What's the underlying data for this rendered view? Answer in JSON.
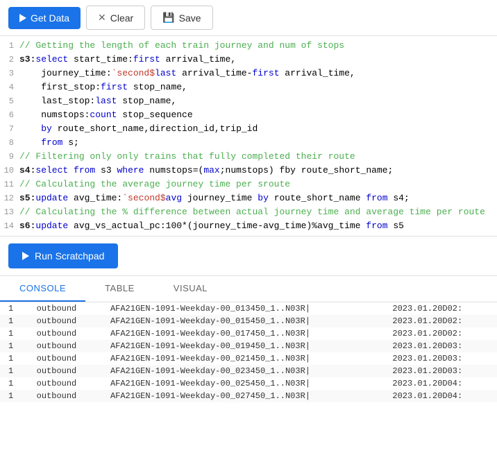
{
  "toolbar": {
    "get_data_label": "Get Data",
    "clear_label": "Clear",
    "save_label": "Save"
  },
  "code": {
    "lines": [
      {
        "num": 1,
        "text": "// Getting the length of each train journey and num of stops",
        "type": "comment"
      },
      {
        "num": 2,
        "text": "s3:select start_time:first arrival_time,",
        "type": "code"
      },
      {
        "num": 3,
        "text": "    journey_time:`second$last arrival_time-first arrival_time,",
        "type": "code"
      },
      {
        "num": 4,
        "text": "    first_stop:first stop_name,",
        "type": "code"
      },
      {
        "num": 5,
        "text": "    last_stop:last stop_name,",
        "type": "code"
      },
      {
        "num": 6,
        "text": "    numstops:count stop_sequence",
        "type": "code"
      },
      {
        "num": 7,
        "text": "    by route_short_name,direction_id,trip_id",
        "type": "code"
      },
      {
        "num": 8,
        "text": "    from s;",
        "type": "code"
      },
      {
        "num": 9,
        "text": "// Filtering only only trains that fully completed their route",
        "type": "comment"
      },
      {
        "num": 10,
        "text": "s4:select from s3 where numstops=(max;numstops) fby route_short_name;",
        "type": "code"
      },
      {
        "num": 11,
        "text": "// Calculating the average journey time per sroute",
        "type": "comment"
      },
      {
        "num": 12,
        "text": "s5:update avg_time:`second$avg journey_time by route_short_name from s4;",
        "type": "code"
      },
      {
        "num": 13,
        "text": "// Calculating the % difference between actual journey time and average time per route",
        "type": "comment"
      },
      {
        "num": 14,
        "text": "s6:update avg_vs_actual_pc:100*(journey_time-avg_time)%avg_time from s5",
        "type": "code"
      }
    ]
  },
  "run_button_label": "Run Scratchpad",
  "tabs": [
    "CONSOLE",
    "TABLE",
    "VISUAL"
  ],
  "active_tab": "CONSOLE",
  "console_rows": [
    {
      "num": "1",
      "dir": "outbound",
      "trip": "AFA21GEN-1091-Weekday-00_013450_1..N03R|",
      "date": "2023.01.20D02:"
    },
    {
      "num": "1",
      "dir": "outbound",
      "trip": "AFA21GEN-1091-Weekday-00_015450_1..N03R|",
      "date": "2023.01.20D02:"
    },
    {
      "num": "1",
      "dir": "outbound",
      "trip": "AFA21GEN-1091-Weekday-00_017450_1..N03R|",
      "date": "2023.01.20D02:"
    },
    {
      "num": "1",
      "dir": "outbound",
      "trip": "AFA21GEN-1091-Weekday-00_019450_1..N03R|",
      "date": "2023.01.20D03:"
    },
    {
      "num": "1",
      "dir": "outbound",
      "trip": "AFA21GEN-1091-Weekday-00_021450_1..N03R|",
      "date": "2023.01.20D03:"
    },
    {
      "num": "1",
      "dir": "outbound",
      "trip": "AFA21GEN-1091-Weekday-00_023450_1..N03R|",
      "date": "2023.01.20D03:"
    },
    {
      "num": "1",
      "dir": "outbound",
      "trip": "AFA21GEN-1091-Weekday-00_025450_1..N03R|",
      "date": "2023.01.20D04:"
    },
    {
      "num": "1",
      "dir": "outbound",
      "trip": "AFA21GEN-1091-Weekday-00_027450_1..N03R|",
      "date": "2023.01.20D04:"
    }
  ]
}
